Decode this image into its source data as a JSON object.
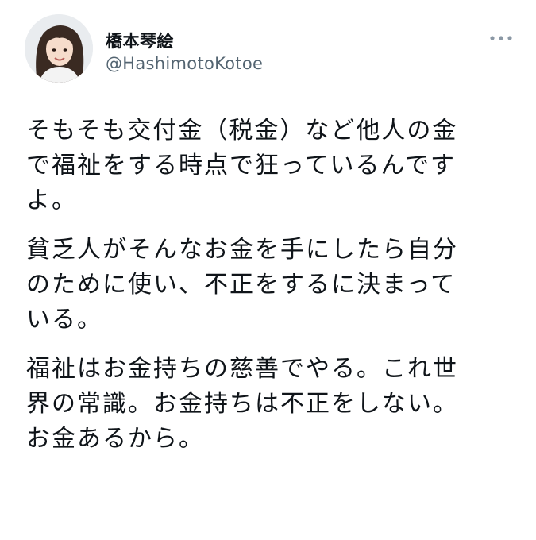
{
  "tweet": {
    "author": {
      "display_name": "橋本琴絵",
      "handle": "@HashimotoKotoe",
      "avatar_icon": "profile-photo"
    },
    "more_icon": "more-options-icon",
    "paragraphs": [
      {
        "lines": [
          "そもそも交付金（税金）など他人の金",
          "で福祉をする時点で狂っているんです",
          "よ。"
        ]
      },
      {
        "lines": [
          "貧乏人がそんなお金を手にしたら自分",
          "のために使い、不正をするに決まって",
          "いる。"
        ]
      },
      {
        "lines": [
          "福祉はお金持ちの慈善でやる。これ世",
          "界の常識。お金持ちは不正をしない。",
          "お金あるから。"
        ]
      }
    ]
  },
  "colors": {
    "text_primary": "#0f1419",
    "text_secondary": "#536471",
    "background": "#ffffff"
  }
}
